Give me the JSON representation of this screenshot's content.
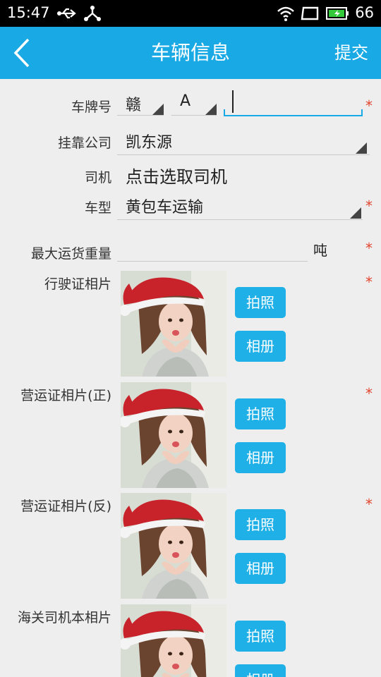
{
  "status_bar": {
    "time": "15:47",
    "battery_level": "66",
    "icons": [
      "usb-icon",
      "share-icon",
      "wifi-icon",
      "window-icon",
      "battery-icon"
    ]
  },
  "header": {
    "title": "车辆信息",
    "submit_label": "提交"
  },
  "form": {
    "plate": {
      "label": "车牌号",
      "province": "赣",
      "letter": "A",
      "number": "",
      "required": "*"
    },
    "company": {
      "label": "挂靠公司",
      "value": "凯东源"
    },
    "driver": {
      "label": "司机",
      "value": "点击选取司机"
    },
    "vehicle_type": {
      "label": "车型",
      "value": "黄包车运输",
      "required": "*"
    },
    "max_weight": {
      "label": "最大运货重量",
      "value": "",
      "unit": "吨",
      "required": "*"
    },
    "photos": [
      {
        "label": "行驶证相片",
        "required": "*",
        "camera_label": "拍照",
        "album_label": "相册"
      },
      {
        "label": "营运证相片(正)",
        "required": "*",
        "camera_label": "拍照",
        "album_label": "相册"
      },
      {
        "label": "营运证相片(反)",
        "required": "*",
        "camera_label": "拍照",
        "album_label": "相册"
      },
      {
        "label": "海关司机本相片",
        "required": "",
        "camera_label": "拍照",
        "album_label": "相册"
      }
    ]
  },
  "colors": {
    "accent": "#19a9e4",
    "button": "#1fb0e7",
    "required": "#e2452f"
  }
}
